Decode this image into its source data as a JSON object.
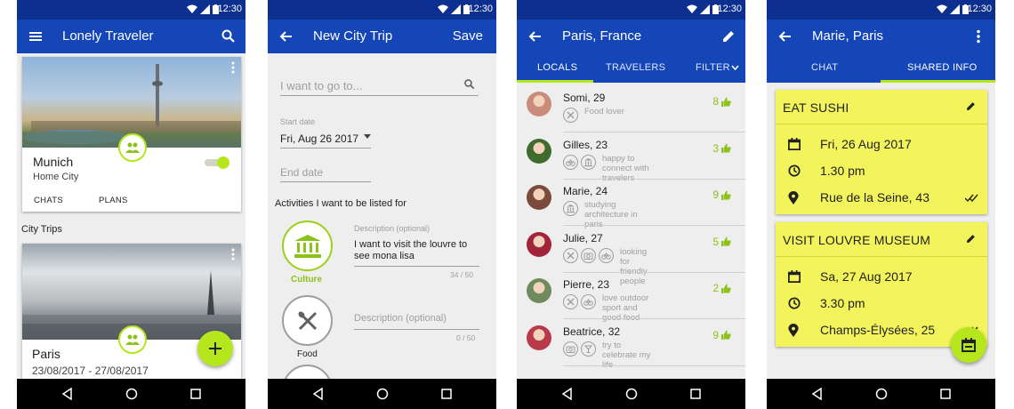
{
  "status": {
    "time": "12:30"
  },
  "screen1": {
    "title": "Lonely Traveler",
    "home_card": {
      "city": "Munich",
      "subtitle": "Home City",
      "tab_chats": "CHATS",
      "tab_plans": "PLANS",
      "toggle_on": true
    },
    "section_label": "City Trips",
    "trip_card": {
      "city": "Paris",
      "dates": "23/08/2017 - 27/08/2017"
    }
  },
  "screen2": {
    "title": "New City Trip",
    "save_label": "Save",
    "search_placeholder": "I want to go to...",
    "start_date_label": "Start date",
    "start_date_value": "Fri, Aug 26 2017",
    "end_date_placeholder": "End date",
    "activities_heading": "Activities I want to be listed for",
    "activities": [
      {
        "label": "Culture",
        "selected": true,
        "desc_label": "Description (optional)",
        "desc_value": "I want to visit the louvre to see mona lisa",
        "counter": "34 / 50"
      },
      {
        "label": "Food",
        "selected": false,
        "desc_placeholder": "Description (optional)",
        "counter": "0 / 50"
      }
    ]
  },
  "screen3": {
    "title": "Paris, France",
    "tabs": [
      "LOCALS",
      "TRAVELERS",
      "FILTER"
    ],
    "people": [
      {
        "name": "Somi, 29",
        "desc": "Food lover",
        "icons": [
          "food-icon"
        ],
        "likes": "8",
        "avatar_color": "#c98b7a"
      },
      {
        "name": "Gilles, 23",
        "desc": "happy to connect with travelers",
        "icons": [
          "bike-icon",
          "museum-icon"
        ],
        "likes": "3",
        "avatar_color": "#3f6b2c"
      },
      {
        "name": "Marie, 24",
        "desc": "studying architecture in paris",
        "icons": [
          "museum-icon"
        ],
        "likes": "9",
        "avatar_color": "#7a4a3a"
      },
      {
        "name": "Julie, 27",
        "desc": "looking for friendly people",
        "icons": [
          "food-icon",
          "camera-icon",
          "bike-icon"
        ],
        "likes": "5",
        "avatar_color": "#a0243a"
      },
      {
        "name": "Pierre, 23",
        "desc": "love outdoor sport and good food",
        "icons": [
          "food-icon",
          "bike-icon"
        ],
        "likes": "2",
        "avatar_color": "#6f8a5c"
      },
      {
        "name": "Beatrice, 32",
        "desc": "try to celebrate my life",
        "icons": [
          "camera-icon",
          "drink-icon"
        ],
        "likes": "9",
        "avatar_color": "#b83a4a"
      }
    ]
  },
  "screen4": {
    "title": "Marie, Paris",
    "tabs": [
      "CHAT",
      "SHARED INFO"
    ],
    "plans": [
      {
        "title": "EAT SUSHI",
        "date": "Fri, 26 Aug 2017",
        "time": "1.30 pm",
        "place": "Rue de la Seine, 43"
      },
      {
        "title": "VISIT LOUVRE MUSEUM",
        "date": "Sa, 27 Aug 2017",
        "time": "3.30 pm",
        "place": "Champs-Élysées, 25"
      }
    ]
  },
  "colors": {
    "statusbar": "#0d2f8f",
    "appbar": "#1446b8",
    "accent": "#b6e61c",
    "plan_card": "#f3f45c"
  }
}
